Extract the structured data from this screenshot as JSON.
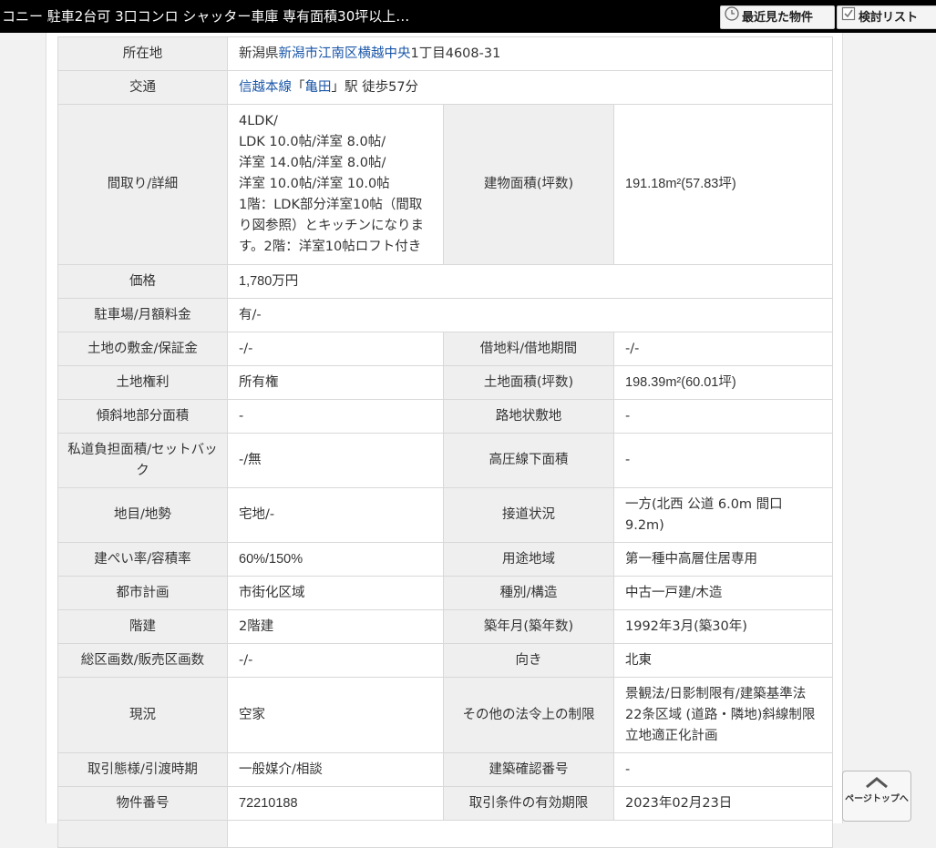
{
  "header": {
    "title": "コニー 駐車2台可 3口コンロ シャッター車庫 専有面積30坪以上…",
    "recent_label": "最近見た物件",
    "list_label": "検討リスト"
  },
  "rows": {
    "location": {
      "label": "所在地",
      "pref": "新潟県",
      "city_link": "新潟市江南区横越中央",
      "rest": "1丁目4608-31"
    },
    "transport": {
      "label": "交通",
      "line_link": "信越本線",
      "q_open": "「",
      "station_link": "亀田",
      "q_close": "」",
      "rest": "駅 徒歩57分"
    },
    "layout": {
      "label": "間取り/詳細",
      "lines": [
        "4LDK/",
        "LDK 10.0帖/洋室 8.0帖/",
        "洋室 14.0帖/洋室 8.0帖/",
        "洋室 10.0帖/洋室 10.0帖",
        "1階：LDK部分洋室10帖（間取",
        "り図参照）とキッチンになりま",
        "す。2階：洋室10帖ロフト付き"
      ],
      "label2": "建物面積(坪数)",
      "value2": "191.18m²(57.83坪)"
    },
    "price": {
      "label": "価格",
      "value": "1,780万円"
    },
    "parking": {
      "label": "駐車場/月額料金",
      "value": "有/-"
    },
    "deposit": {
      "label": "土地の敷金/保証金",
      "value": "-/-",
      "label2": "借地料/借地期間",
      "value2": "-/-"
    },
    "land_right": {
      "label": "土地権利",
      "value": "所有権",
      "label2": "土地面積(坪数)",
      "value2": "198.39m²(60.01坪)"
    },
    "slope": {
      "label": "傾斜地部分面積",
      "value": "-",
      "label2": "路地状敷地",
      "value2": "-"
    },
    "private_road": {
      "label": "私道負担面積/セットバック",
      "value": "-/無",
      "label2": "高圧線下面積",
      "value2": "-"
    },
    "land_category": {
      "label": "地目/地勢",
      "value": "宅地/-",
      "label2": "接道状況",
      "value2": "一方(北西 公道 6.0m 間口 9.2m)"
    },
    "coverage": {
      "label": "建ぺい率/容積率",
      "value": "60%/150%",
      "label2": "用途地域",
      "value2": "第一種中高層住居専用"
    },
    "city_plan": {
      "label": "都市計画",
      "value": "市街化区域",
      "label2": "種別/構造",
      "value2": "中古一戸建/木造"
    },
    "floors": {
      "label": "階建",
      "value": "2階建",
      "label2": "築年月(築年数)",
      "value2": "1992年3月(築30年)"
    },
    "lots": {
      "label": "総区画数/販売区画数",
      "value": "-/-",
      "label2": "向き",
      "value2": "北東"
    },
    "status": {
      "label": "現況",
      "value": "空家",
      "label2": "その他の法令上の制限",
      "value2": "景観法/日影制限有/建築基準法22条区域 (道路・隣地)斜線制限 立地適正化計画"
    },
    "transaction": {
      "label": "取引態様/引渡時期",
      "value": "一般媒介/相談",
      "label2": "建築確認番号",
      "value2": "-"
    },
    "property_no": {
      "label": "物件番号",
      "value": "72210188",
      "label2": "取引条件の有効期限",
      "value2": "2023年02月23日"
    }
  },
  "page_top": {
    "label": "ページトップへ"
  }
}
